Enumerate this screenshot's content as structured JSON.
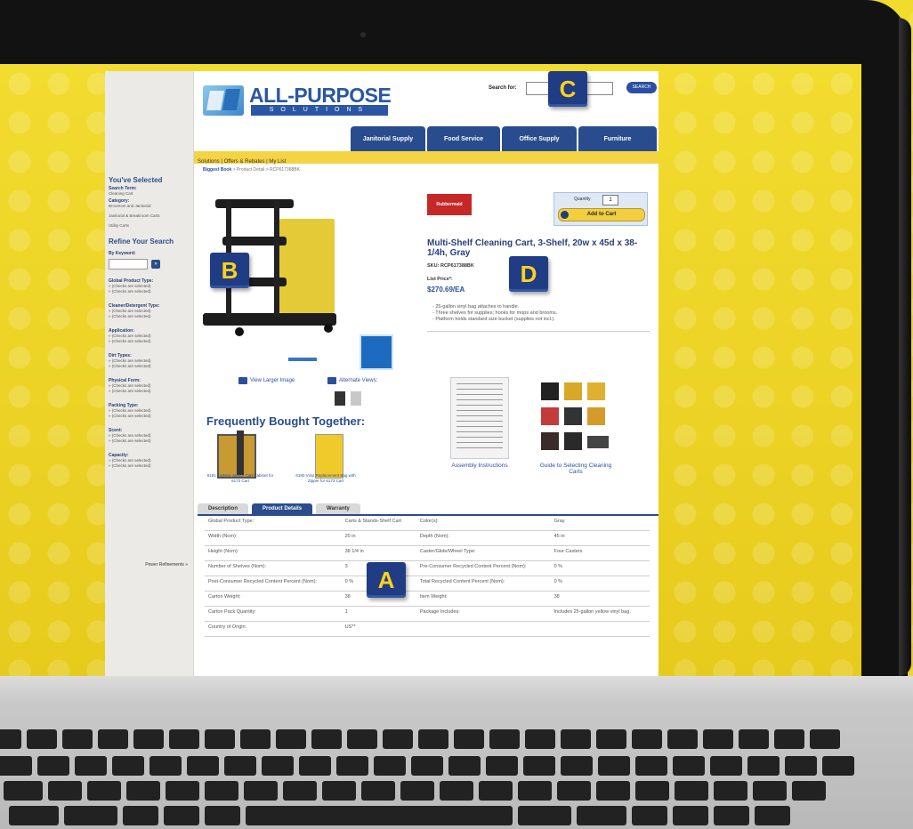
{
  "site": {
    "logo_text": "ALL-PURPOSE",
    "logo_sub": "SOLUTIONS",
    "search_label": "Search for:",
    "search_button": "SEARCH",
    "nav_tabs": [
      "Janitorial Supply",
      "Food Service",
      "Office Supply",
      "Furniture"
    ],
    "subnav": "Solutions | Offers & Rebates | My List",
    "breadcrumb_link": "Biggest Book",
    "breadcrumb_rest": " > Product Detail > RCP617388BK"
  },
  "sidebar": {
    "selected_heading": "You've Selected",
    "selected_sections": [
      {
        "head": "Search Term:",
        "item": "Cleaning Cart"
      },
      {
        "head": "Category:",
        "item": "Broomom and Janitorial"
      },
      {
        "head": "",
        "item": "Janitorial & Breakroom Carts"
      },
      {
        "head": "",
        "item": "Utility Carts"
      }
    ],
    "refine_heading": "Refine Your Search",
    "keyword_label": "By Keyword:",
    "keyword_go": "»",
    "facets": [
      {
        "head": "Global Product Type:"
      },
      {
        "head": "Cleaner/Detergent Type:"
      },
      {
        "head": "Application:"
      },
      {
        "head": "Dirt Types:"
      },
      {
        "head": "Physical Form:"
      },
      {
        "head": "Packing Type:"
      },
      {
        "head": "Scent:"
      },
      {
        "head": "Capacity:"
      }
    ],
    "facet_items": [
      "» (Checks are selected)",
      "» (Checks are selected)"
    ],
    "power_refinements": "Power Refinements »"
  },
  "product": {
    "brand": "Rubbermaid",
    "quantity_label": "Quantity",
    "quantity_value": "1",
    "add_to_cart": "Add to Cart",
    "title": "Multi-Shelf Cleaning Cart, 3-Shelf, 20w x 45d x 38-1/4h, Gray",
    "sku": "SKU: RCP617388BK",
    "list_price_label": "List Price*:",
    "price": "$270.69/EA",
    "bullets": [
      "- 25-gallon vinyl bag attaches to handle.",
      "- Three shelves for supplies; hooks for mops and brooms.",
      "- Platform holds standard size bucket (supplies not incl.)."
    ],
    "view_larger": "View Larger Image",
    "alternate_views": "Alternate Views:"
  },
  "fbt": {
    "title": "Frequently Bought Together:",
    "items": [
      {
        "caption": "6181 Locking Janitor Cart Cabinet for 6173 Cart"
      },
      {
        "caption": "6180 Vinyl Replacement Bag with Zipper for 6173 Cart"
      }
    ]
  },
  "docs": [
    {
      "caption": "Assembly Instructions"
    },
    {
      "caption": "Guide to Selecting Cleaning Carts"
    }
  ],
  "tabs": [
    "Description",
    "Product Details",
    "Warranty"
  ],
  "specs": [
    [
      "Global Product Type:",
      "Carts & Stands-Shelf Cart",
      "Color(s):",
      "Gray"
    ],
    [
      "Width (Nom):",
      "20 in",
      "Depth (Nom):",
      "45 in"
    ],
    [
      "Height (Nom):",
      "38 1/4 in",
      "Caster/Glide/Wheel Type:",
      "Four Casters"
    ],
    [
      "Number of Shelves (Nom):",
      "3",
      "Pre-Consumer Recycled Content Percent (Nom):",
      "0 %"
    ],
    [
      "Post-Consumer Recycled Content Percent (Nom):",
      "0 %",
      "Total Recycled Content Percent (Nom):",
      "0 %"
    ],
    [
      "Carton Weight:",
      "38",
      "Item Weight:",
      "38"
    ],
    [
      "Carton Pack Quantity:",
      "1",
      "Package Includes:",
      "Includes 25-gallon yellow vinyl bag."
    ],
    [
      "Country of Origin:",
      "US**",
      "",
      ""
    ]
  ],
  "markers": {
    "a": "A",
    "b": "B",
    "c": "C",
    "d": "D"
  },
  "colors": {
    "brand_blue": "#2b4d8c",
    "accent_yellow": "#f0d624",
    "marker_bg": "#1f3c84",
    "marker_text": "#ffd21a"
  }
}
